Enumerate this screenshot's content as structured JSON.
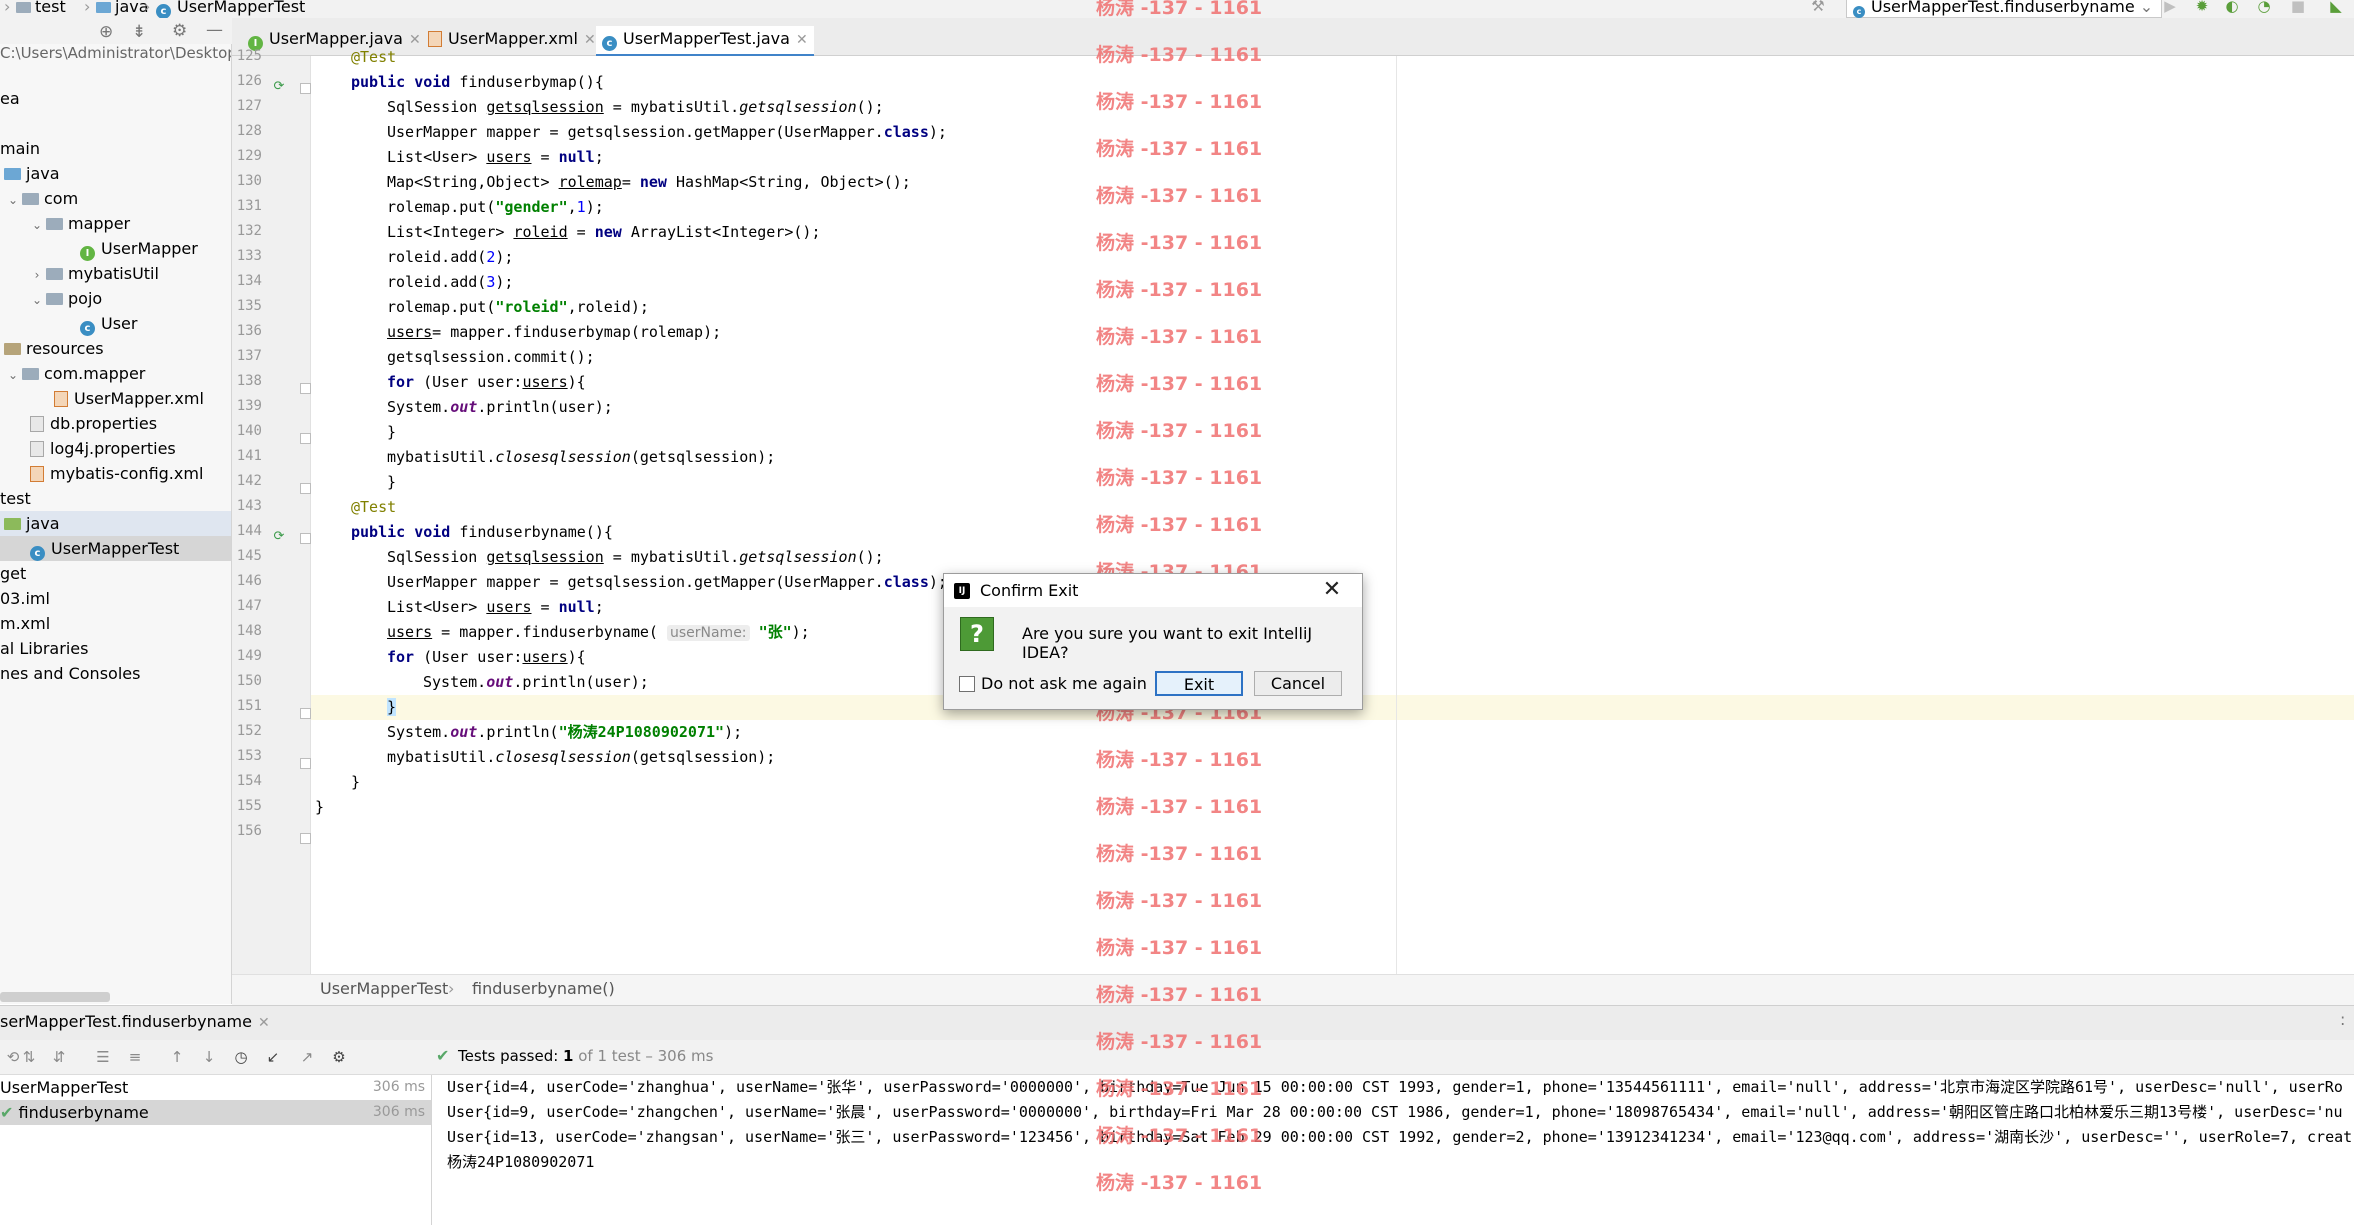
{
  "nav": {
    "crumbs": [
      "test",
      "java",
      "UserMapperTest"
    ],
    "run_config": "UserMapperTest.finduserbyname"
  },
  "tree": {
    "path": "C:\\Users\\Administrator\\Desktop\\",
    "items": [
      {
        "label": "ea"
      },
      {
        "label": "main"
      },
      {
        "label": "java"
      },
      {
        "label": "com"
      },
      {
        "label": "mapper"
      },
      {
        "label": "UserMapper"
      },
      {
        "label": "mybatisUtil"
      },
      {
        "label": "pojo"
      },
      {
        "label": "User"
      },
      {
        "label": "resources"
      },
      {
        "label": "com.mapper"
      },
      {
        "label": "UserMapper.xml"
      },
      {
        "label": "db.properties"
      },
      {
        "label": "log4j.properties"
      },
      {
        "label": "mybatis-config.xml"
      },
      {
        "label": "test"
      },
      {
        "label": "java"
      },
      {
        "label": "UserMapperTest"
      },
      {
        "label": "get"
      },
      {
        "label": "03.iml"
      },
      {
        "label": "m.xml"
      },
      {
        "label": "al Libraries"
      },
      {
        "label": "nes and Consoles"
      }
    ]
  },
  "tabs": [
    {
      "label": "UserMapper.java"
    },
    {
      "label": "UserMapper.xml"
    },
    {
      "label": "UserMapperTest.java"
    }
  ],
  "code": {
    "line_numbers": [
      "125",
      "126",
      "127",
      "128",
      "129",
      "130",
      "131",
      "132",
      "133",
      "134",
      "135",
      "136",
      "137",
      "138",
      "139",
      "140",
      "141",
      "142",
      "143",
      "144",
      "145",
      "146",
      "147",
      "148",
      "149",
      "150",
      "151",
      "152",
      "153",
      "154",
      "155",
      "156"
    ],
    "lines": {
      "l125": "@Test",
      "l126_kw": "public void ",
      "l126_rest": "finduserbymap(){",
      "l127_a": "SqlSession ",
      "l127_b": "getsqlsession",
      "l127_c": " = mybatisUtil.",
      "l127_d": "getsqlsession",
      "l127_e": "();",
      "l128_a": "UserMapper mapper = getsqlsession.getMapper(UserMapper.",
      "l128_b": "class",
      "l128_c": ");",
      "l129_a": "List<User> ",
      "l129_b": "users",
      "l129_c": " = ",
      "l129_d": "null",
      "l129_e": ";",
      "l130_a": "Map<String,Object> ",
      "l130_b": "rolemap",
      "l130_c": "= ",
      "l130_d": "new",
      "l130_e": " HashMap<String, Object>();",
      "l131_a": "rolemap.put(",
      "l131_b": "\"gender\"",
      "l131_c": ",",
      "l131_d": "1",
      "l131_e": ");",
      "l132_a": "List<Integer> ",
      "l132_b": "roleid",
      "l132_c": " = ",
      "l132_d": "new",
      "l132_e": " ArrayList<Integer>();",
      "l133_a": "roleid.add(",
      "l133_b": "2",
      "l133_c": ");",
      "l134_a": "roleid.add(",
      "l134_b": "3",
      "l134_c": ");",
      "l135_a": "rolemap.put(",
      "l135_b": "\"roleid\"",
      "l135_c": ",roleid);",
      "l136_a": "users",
      "l136_b": "= mapper.finduserbymap(rolemap);",
      "l137": "getsqlsession.commit();",
      "l138_a": "for",
      "l138_b": " (User user:",
      "l138_c": "users",
      "l138_d": "){",
      "l139_a": "System.",
      "l139_b": "out",
      "l139_c": ".println(user);",
      "l140": "}",
      "l141_a": "mybatisUtil.",
      "l141_b": "closesqlsession",
      "l141_c": "(getsqlsession);",
      "l142": "}",
      "l143": "@Test",
      "l144_kw": "public void ",
      "l144_rest": "finduserbyname(){",
      "l148_a": "users",
      "l148_b": " = mapper.finduserbyname( ",
      "l148_hint": "userName:",
      "l148_c": " ",
      "l148_d": "\"张\"",
      "l148_e": ");",
      "l150_a": "System.",
      "l150_b": "out",
      "l150_c": ".println(user);",
      "l151": "}",
      "l152_a": "System.",
      "l152_b": "out",
      "l152_c": ".println(",
      "l152_d": "\"杨涛24P1080902071\"",
      "l152_e": ");",
      "l154": "}",
      "l155": "}"
    }
  },
  "editor_crumbs": {
    "class": "UserMapperTest",
    "method": "finduserbyname()"
  },
  "run": {
    "tab_label": "serMapperTest.finduserbyname",
    "status_prefix": "Tests passed: ",
    "status_count": "1",
    "status_rest": " of 1 test – 306 ms",
    "tests": [
      {
        "label": "UserMapperTest",
        "time": "306 ms"
      },
      {
        "label": "finduserbyname",
        "time": "306 ms"
      }
    ],
    "console": [
      "User{id=4, userCode='zhanghua', userName='张华', userPassword='0000000', birthday=Tue Jun 15 00:00:00 CST 1993, gender=1, phone='13544561111', email='null', address='北京市海淀区学院路61号', userDesc='null', userRo",
      "User{id=9, userCode='zhangchen', userName='张晨', userPassword='0000000', birthday=Fri Mar 28 00:00:00 CST 1986, gender=1, phone='18098765434', email='null', address='朝阳区管庄路口北柏林爱乐三期13号楼', userDesc='nu",
      "User{id=13, userCode='zhangsan', userName='张三', userPassword='123456', birthday=Sat Feb 29 00:00:00 CST 1992, gender=2, phone='13912341234', email='123@qq.com', address='湖南长沙', userDesc='', userRole=7, creat",
      "杨涛24P1080902071"
    ]
  },
  "dialog": {
    "title": "Confirm Exit",
    "message": "Are you sure you want to exit IntelliJ IDEA?",
    "checkbox_label": "Do not ask me again",
    "exit_label": "Exit",
    "cancel_label": "Cancel",
    "close_glyph": "✕",
    "question_glyph": "?",
    "logo_text": "IJ"
  },
  "watermark": "杨涛 -137 - 1161",
  "colors": {
    "keyword": "#000080",
    "string": "#008000",
    "annotation": "#808000",
    "watermark": "#f07070",
    "accent": "#4083c9"
  }
}
